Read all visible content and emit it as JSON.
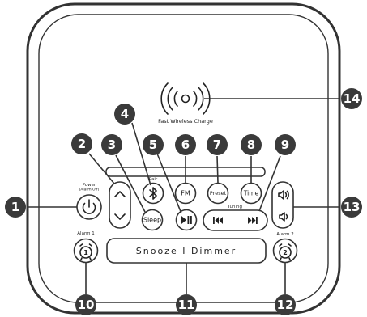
{
  "wireless_charge_label": "Fast Wireless Charge",
  "power_label": "Power",
  "power_sublabel": "(Alarm Off)",
  "pair_label": "Pair",
  "tuning_label": "Tuning",
  "alarm1_label": "Alarm 1",
  "alarm2_label": "Alarm 2",
  "buttons": {
    "sleep": "Sleep",
    "fm": "FM",
    "preset": "Preset",
    "time": "Time",
    "snooze_dimmer": "Snooze I Dimmer",
    "alarm1_number": "1",
    "alarm2_number": "2"
  },
  "callouts": [
    "1",
    "2",
    "3",
    "4",
    "5",
    "6",
    "7",
    "8",
    "9",
    "10",
    "11",
    "12",
    "13",
    "14"
  ]
}
